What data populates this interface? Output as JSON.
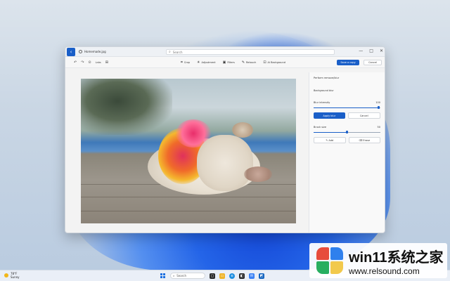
{
  "window": {
    "file_name": "Homemade.jpg",
    "search_placeholder": "Search",
    "controls": [
      "—",
      "□",
      "✕"
    ]
  },
  "toolbar": {
    "left_tools": [
      "↶",
      "↷",
      "⊙",
      "Labs",
      "⊞"
    ],
    "items": [
      {
        "icon": "crop-icon",
        "glyph": "⌗",
        "label": "Crop"
      },
      {
        "icon": "adjust-icon",
        "glyph": "☀",
        "label": "Adjustment"
      },
      {
        "icon": "filter-icon",
        "glyph": "▣",
        "label": "Filters"
      },
      {
        "icon": "retouch-icon",
        "glyph": "✎",
        "label": "Retouch"
      },
      {
        "icon": "background-icon",
        "glyph": "⊡",
        "label": "AI Background"
      }
    ],
    "save_label": "Save a copy",
    "cancel_label": "Cancel"
  },
  "panel": {
    "title": "Perform remove/blur",
    "section": "Background blur",
    "blur_label": "Blur intensity",
    "blur_value": "100",
    "blur_fraction": 0.97,
    "apply_label": "Apply blur",
    "cancel_label": "Cancel",
    "brush_label": "Brush size",
    "brush_value": "50",
    "brush_fraction": 0.5,
    "add_label": "Add",
    "erase_label": "Erase"
  },
  "taskbar": {
    "temp": "78°F",
    "condition": "Sunny",
    "search_label": "Search"
  },
  "watermark": {
    "title": "win11系统之家",
    "url": "www.relsound.com"
  },
  "colors": {
    "accent": "#1a5fc8"
  }
}
